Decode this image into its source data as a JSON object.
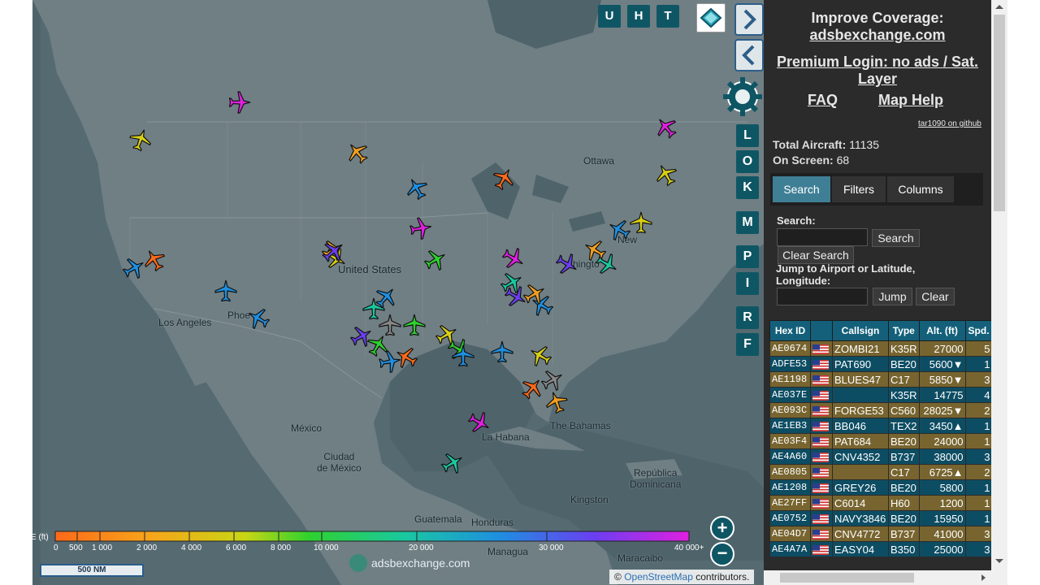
{
  "map": {
    "cities": [
      {
        "name": "Ottawa"
      },
      {
        "name": "United States"
      },
      {
        "name": "Los Angeles"
      },
      {
        "name": "Phoe"
      },
      {
        "name": "New"
      },
      {
        "name": "hingto"
      },
      {
        "name": "México"
      },
      {
        "name": "Ciudad\nde México"
      },
      {
        "name": "La Habana"
      },
      {
        "name": "The Bahamas"
      },
      {
        "name": "Kingston"
      },
      {
        "name": "República\nDominicana"
      },
      {
        "name": "Guatemala"
      },
      {
        "name": "Honduras"
      },
      {
        "name": "Managua"
      },
      {
        "name": "Maracaibo"
      }
    ],
    "top_buttons": [
      "U",
      "H",
      "T"
    ],
    "side_buttons": [
      "L",
      "O",
      "K",
      "M",
      "P",
      "I",
      "R",
      "F"
    ],
    "zoom_in_label": "+",
    "zoom_out_label": "−",
    "legend_title": "E (ft)",
    "legend_ticks": [
      "0",
      "500",
      "1 000",
      "2 000",
      "4 000",
      "6 000",
      "8 000",
      "10 000",
      "20 000",
      "30 000",
      "40 000+"
    ],
    "logo_text": "adsbexchange.com",
    "scale_label": "500 NM",
    "attribution_prefix": "©",
    "attribution_link": "OpenStreetMap",
    "attribution_suffix": "contributors."
  },
  "panel": {
    "coverage_line1": "Improve Coverage:",
    "coverage_link": "adsbexchange.com",
    "premium_link": "Premium Login: no ads / Sat. Layer",
    "faq_link": "FAQ",
    "help_link": "Map Help",
    "github_link": "tar1090 on github",
    "total_label": "Total Aircraft:",
    "total_value": "11135",
    "onscreen_label": "On Screen:",
    "onscreen_value": "68",
    "tabs": [
      "Search",
      "Filters",
      "Columns"
    ],
    "search_label": "Search:",
    "search_button": "Search",
    "clear_search_button": "Clear Search",
    "jump_label": "Jump to Airport or Latitude, Longitude:",
    "jump_button": "Jump",
    "clear_button": "Clear"
  },
  "table": {
    "columns": [
      "Hex ID",
      "",
      "Callsign",
      "Type",
      "Alt. (ft)",
      "Spd."
    ],
    "rows": [
      {
        "hex": "AE0674",
        "callsign": "ZOMBI21",
        "type": "K35R",
        "alt": "27000",
        "spd": "5"
      },
      {
        "hex": "ADFE53",
        "callsign": "PAT690",
        "type": "BE20",
        "alt": "5600▼",
        "spd": "1"
      },
      {
        "hex": "AE1198",
        "callsign": "BLUES47",
        "type": "C17",
        "alt": "5850▼",
        "spd": "3"
      },
      {
        "hex": "AE037E",
        "callsign": "",
        "type": "K35R",
        "alt": "14775",
        "spd": "4"
      },
      {
        "hex": "AE093C",
        "callsign": "FORGE53",
        "type": "C560",
        "alt": "28025▼",
        "spd": "2"
      },
      {
        "hex": "AE1EB3",
        "callsign": "BB046",
        "type": "TEX2",
        "alt": "3450▲",
        "spd": "1"
      },
      {
        "hex": "AE03F4",
        "callsign": "PAT684",
        "type": "BE20",
        "alt": "24000",
        "spd": "1"
      },
      {
        "hex": "AE4A60",
        "callsign": "CNV4352",
        "type": "B737",
        "alt": "38000",
        "spd": "3"
      },
      {
        "hex": "AE0805",
        "callsign": "",
        "type": "C17",
        "alt": "6725▲",
        "spd": "2"
      },
      {
        "hex": "AE1208",
        "callsign": "GREY26",
        "type": "BE20",
        "alt": "5800",
        "spd": "1"
      },
      {
        "hex": "AE27FF",
        "callsign": "C6014",
        "type": "H60",
        "alt": "1200",
        "spd": "1"
      },
      {
        "hex": "AE0752",
        "callsign": "NAVY3846",
        "type": "BE20",
        "alt": "15950",
        "spd": "1"
      },
      {
        "hex": "AE04D7",
        "callsign": "CNV4772",
        "type": "B737",
        "alt": "41000",
        "spd": "3"
      },
      {
        "hex": "AE4A7A",
        "callsign": "EASY04",
        "type": "B350",
        "alt": "25000",
        "spd": "3"
      }
    ]
  },
  "colors": {
    "map_bg": "#566a72",
    "panel_bg": "#2b2b2b",
    "header_bg": "#14607a",
    "row_odd": "#77642f",
    "row_even": "#0d4d63",
    "tab_active": "#3f7f96",
    "button_teal": "#0f5665"
  }
}
